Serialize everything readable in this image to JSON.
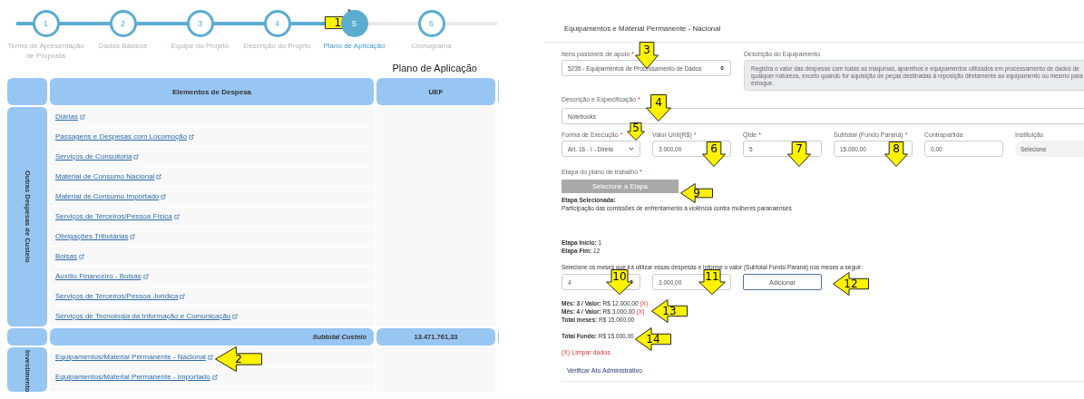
{
  "stepper": {
    "steps": [
      {
        "number": "1",
        "label": "Termo de Apresentação de Proposta",
        "selected": false
      },
      {
        "number": "2",
        "label": "Dados Básicos",
        "selected": false
      },
      {
        "number": "3",
        "label": "Equipe do Projeto",
        "selected": false
      },
      {
        "number": "4",
        "label": "Descrição do Projeto",
        "selected": false
      },
      {
        "number": "5",
        "label": "Plano de Aplicação",
        "selected": true
      },
      {
        "number": "6",
        "label": "Cronograma",
        "selected": false
      }
    ]
  },
  "plan": {
    "title": "Plano de Aplicação",
    "columns": [
      "Elementos de Despesa",
      "UEF"
    ],
    "sections": [
      {
        "kind": "group",
        "label": "Outras Despesas de Custeio",
        "items": [
          "Diárias",
          "Passagens e Despesas com Locomoção",
          "Serviços de Consultoria",
          "Material de Consumo Nacional",
          "Material de Consumo Importado",
          "Serviços de Terceiros/Pessoa Física",
          "Obrigações Tributárias",
          "Bolsas",
          "Auxílio Financeiro - Bolsas",
          "Serviços de Terceiros/Pessoa Jurídica",
          "Serviços de Tecnologia da Informação e Comunicação"
        ]
      },
      {
        "kind": "subtotal",
        "label": "Subtotal Custeio",
        "value": "13.471.761,33"
      },
      {
        "kind": "group",
        "label": "Investimento",
        "items": [
          "Equipamentos/Material Permanente - Nacional",
          "Equipamentos/Material Permanente - Importado"
        ]
      }
    ]
  },
  "modal": {
    "title": "Equipamentos e Material Permanente - Nacional",
    "support_item": {
      "label": "Itens passíveis de apoio",
      "required_mark": "*",
      "value": "5235 - Equipamentos de Processamento de Dados"
    },
    "equipment_description": {
      "label": "Descrição do Equipamento",
      "value": "Registra o valor das despesas com todas as máquinas, aparelhos e equipamentos utilizados em processamento de dados de qualquer natureza, exceto quando for aquisição de peças destinadas à reposição diretamente ao equipamento ou mesmo para estoque."
    },
    "specification": {
      "label": "Descrição e Especificação",
      "required_mark": "*",
      "value": "Notebooks"
    },
    "row_fields": [
      {
        "kind": "select",
        "label": "Forma de Execução",
        "required_mark": "*",
        "value": "Art. 16 - I - Direta"
      },
      {
        "kind": "input",
        "label": "Valor Unit(R$)",
        "required_mark": "*",
        "value": "3.000,00"
      },
      {
        "kind": "input",
        "label": "Qtde",
        "required_mark": "*",
        "value": "5"
      },
      {
        "kind": "input",
        "label": "Subtotal (Fundo Paraná)",
        "required_mark": "*",
        "value": "15.000,00"
      },
      {
        "kind": "input",
        "label": "Contrapartida",
        "value": "0,00"
      },
      {
        "kind": "pill",
        "label": "Instituição",
        "value": "Selecione"
      }
    ],
    "stage": {
      "label": "Etapa do plano de trabalho",
      "required_mark": "*",
      "button": "Selecione a Etapa",
      "disabled": true,
      "selected_heading": "Etapa Selecionada:",
      "selected_text": "Participação das comissões de enfrentamento à violência contra mulheres paranaenses"
    },
    "stage_start": {
      "label": "Etapa Início:",
      "value": "1"
    },
    "stage_end": {
      "label": "Etapa Fim:",
      "value": "12"
    },
    "months_prompt": "Selecione os meses que irá utilizar essas despesas e informe o valor (Subtotal Fundo Paraná) nos meses a seguir:",
    "month_select": "4",
    "month_value": "3.000,00",
    "add_button": "Adicionar",
    "month_entries": [
      {
        "label": "Mês: 3 / Valor:",
        "value": "R$ 12.000,00",
        "remove": "(X)"
      },
      {
        "label": "Mês: 4 / Valor:",
        "value": "R$ 3.000,00",
        "remove": "(X)"
      }
    ],
    "total_months": {
      "label": "Total meses:",
      "value": "R$ 15.000,00"
    },
    "total_fund": {
      "label": "Total Fundo:",
      "value": "R$ 15.000,00"
    },
    "clear_link": "(X) Limpar dados",
    "verify_link": "Verificar Ato Administrativo"
  },
  "callouts": [
    {
      "label": "1",
      "kind": "right"
    },
    {
      "label": "2",
      "kind": "left"
    },
    {
      "label": "3",
      "kind": "down"
    },
    {
      "label": "4",
      "kind": "down"
    },
    {
      "label": "5",
      "kind": "down"
    },
    {
      "label": "6",
      "kind": "down"
    },
    {
      "label": "7",
      "kind": "down"
    },
    {
      "label": "8",
      "kind": "down"
    },
    {
      "label": "9",
      "kind": "left"
    },
    {
      "label": "10",
      "kind": "down"
    },
    {
      "label": "11",
      "kind": "down"
    },
    {
      "label": "12",
      "kind": "left"
    },
    {
      "label": "13",
      "kind": "left"
    },
    {
      "label": "14",
      "kind": "left"
    }
  ]
}
